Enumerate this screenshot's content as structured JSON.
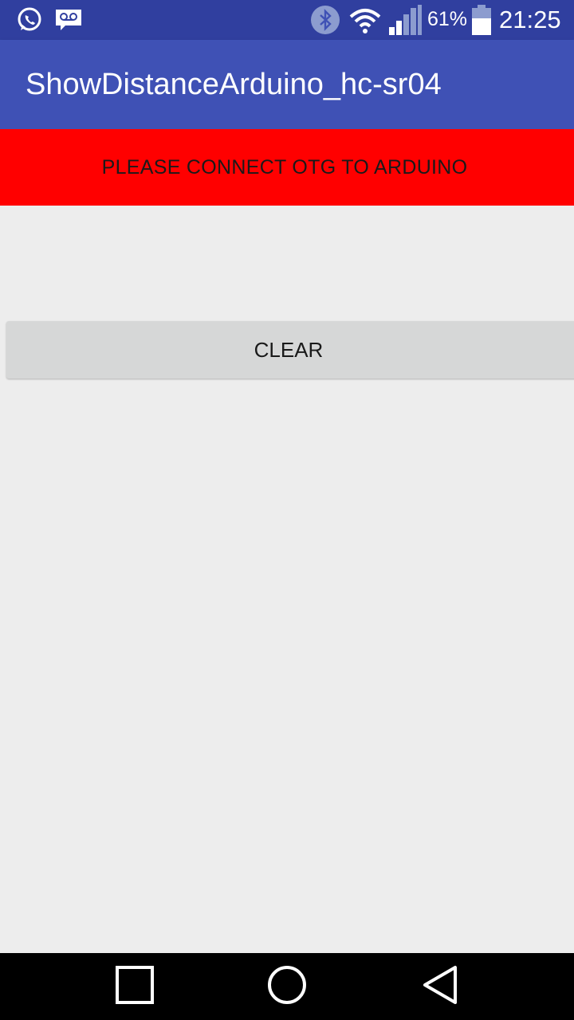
{
  "status_bar": {
    "battery_percent": "61%",
    "time": "21:25",
    "icons": [
      "whatsapp-icon",
      "voicemail-icon",
      "bluetooth-icon",
      "wifi-icon",
      "cell-signal-icon",
      "battery-icon"
    ],
    "battery_level": 0.61
  },
  "app_bar": {
    "title": "ShowDistanceArduino_hc-sr04"
  },
  "banner": {
    "message": "PLEASE CONNECT OTG TO ARDUINO",
    "color": "#ff0000"
  },
  "main": {
    "clear_label": "CLEAR"
  },
  "nav_bar": {
    "icons": [
      "recents-icon",
      "home-icon",
      "back-icon"
    ]
  },
  "colors": {
    "status_bar": "#303f9f",
    "app_bar": "#3f51b5",
    "background": "#ededed",
    "button": "#d6d7d7"
  }
}
